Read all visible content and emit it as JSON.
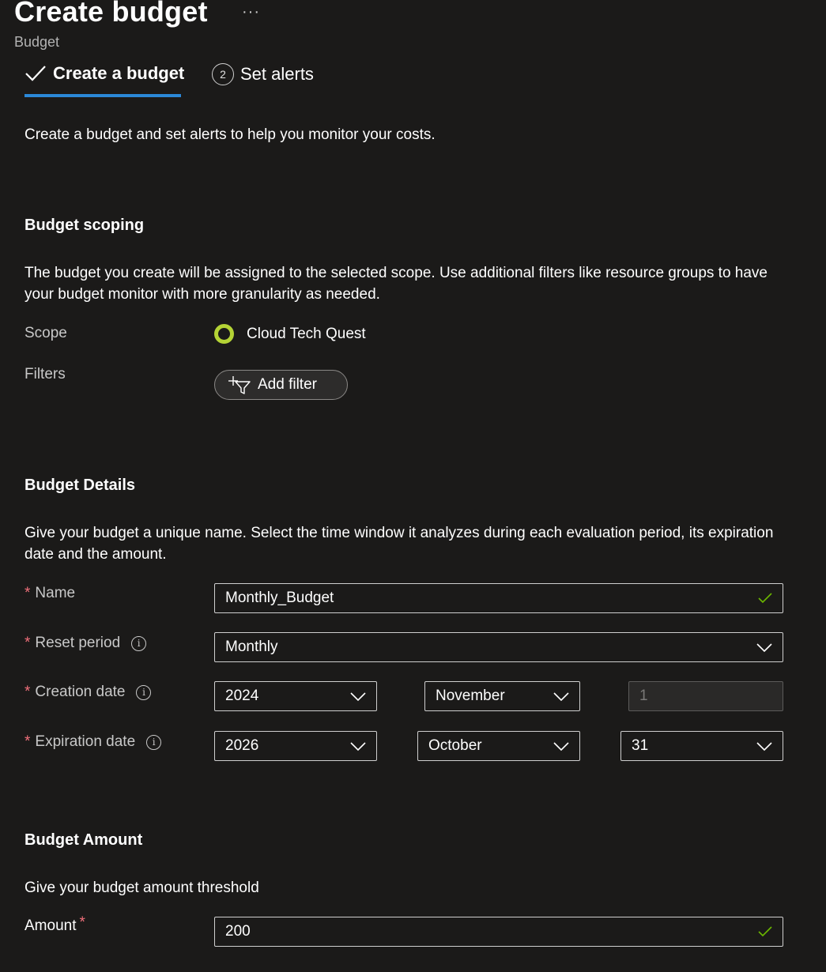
{
  "header": {
    "title": "Create budget",
    "more": "···",
    "subtitle": "Budget"
  },
  "tabs": [
    {
      "label": "Create a budget",
      "state": "completed"
    },
    {
      "label": "Set alerts",
      "step": "2"
    }
  ],
  "intro": "Create a budget and set alerts to help you monitor your costs.",
  "scoping": {
    "title": "Budget scoping",
    "description": "The budget you create will be assigned to the selected scope. Use additional filters like resource groups to have your budget monitor with more granularity as needed.",
    "scope_label": "Scope",
    "scope_value": "Cloud Tech Quest",
    "filters_label": "Filters",
    "add_filter": "Add filter"
  },
  "details": {
    "title": "Budget Details",
    "description": "Give your budget a unique name. Select the time window it analyzes during each evaluation period, its expiration date and the amount.",
    "required_mark": "*",
    "name_label": "Name",
    "name_value": "Monthly_Budget",
    "reset_label": "Reset period",
    "reset_value": "Monthly",
    "creation_label": "Creation date",
    "creation_year": "2024",
    "creation_month": "November",
    "creation_day": "1",
    "expiration_label": "Expiration date",
    "expiration_year": "2026",
    "expiration_month": "October",
    "expiration_day": "31",
    "info_glyph": "i"
  },
  "amount": {
    "title": "Budget Amount",
    "description": "Give your budget amount threshold",
    "label": "Amount",
    "value": "200"
  },
  "colors": {
    "background": "#1b1a19",
    "accent": "#2b88d8",
    "required": "#f1707b",
    "valid_check": "#6bb700",
    "scope_ring": "#b4d335"
  }
}
